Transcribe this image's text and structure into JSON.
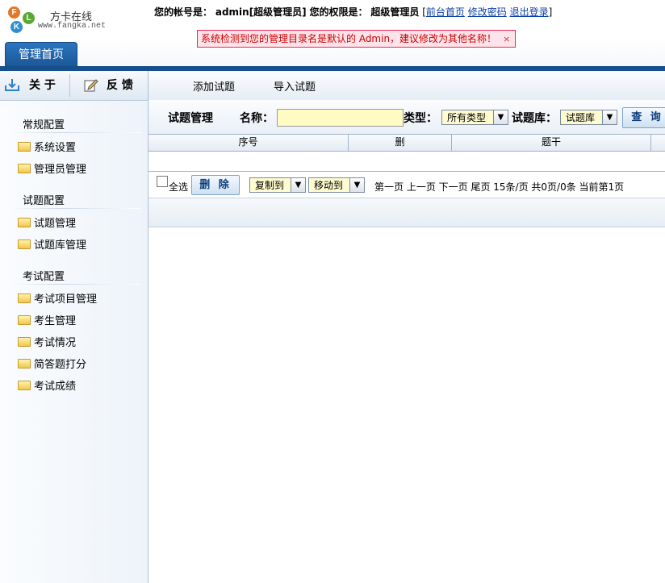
{
  "brand": {
    "logo_letters": [
      "F",
      "L",
      "K"
    ],
    "name": "方卡在线",
    "url": "www.fangka.net"
  },
  "userbar": {
    "account_label": "您的帐号是：",
    "account_value": "admin[超级管理员]",
    "role_label": "您的权限是：",
    "role_value": "超级管理员",
    "bracket_open": "[",
    "bracket_close": "]",
    "link_home": "前台首页",
    "link_password": "修改密码",
    "link_logout": "退出登录"
  },
  "warning": {
    "text": "系统检测到您的管理目录名是默认的 Admin，建议修改为其他名称！",
    "close": "×"
  },
  "top_tab": "管理首页",
  "side_buttons": {
    "about": "关 于",
    "feedback": "反 馈"
  },
  "sidebar": {
    "sections": [
      {
        "title": "常规配置",
        "items": [
          "系统设置",
          "管理员管理"
        ]
      },
      {
        "title": "试题配置",
        "items": [
          "试题管理",
          "试题库管理"
        ]
      },
      {
        "title": "考试配置",
        "items": [
          "考试项目管理",
          "考生管理",
          "考试情况",
          "简答题打分",
          "考试成绩"
        ]
      }
    ]
  },
  "subnav": {
    "add": "添加试题",
    "import": "导入试题"
  },
  "search": {
    "module_title": "试题管理",
    "name_label": "名称：",
    "name_value": "",
    "type_label": "类型：",
    "type_selected": "所有类型",
    "bank_label": "试题库：",
    "bank_selected": "试题库",
    "query_button": "查 询"
  },
  "table": {
    "columns": [
      "序号",
      "删",
      "题干"
    ]
  },
  "footer": {
    "select_all": "全选",
    "delete_button": "删 除",
    "copy_selected": "复制到",
    "move_selected": "移动到",
    "pager": "第一页 上一页 下一页 尾页 15条/页 共0页/0条 当前第1页"
  },
  "colors": {
    "accent": "#174f8c",
    "warning_bg": "#fde4ea",
    "input_bg": "#fffbc2"
  }
}
